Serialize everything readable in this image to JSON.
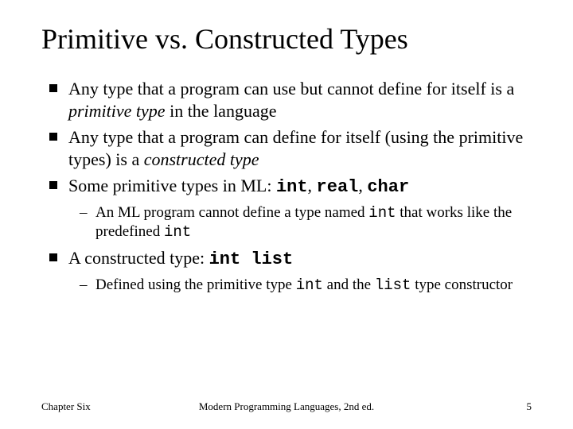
{
  "title": "Primitive vs. Constructed Types",
  "bullets": {
    "b1a": "Any type that a program can use but cannot define for itself is a ",
    "b1b": "primitive type",
    "b1c": " in the language",
    "b2a": "Any type that a program can define for itself (using the primitive types) is a ",
    "b2b": "constructed type",
    "b3a": "Some primitive types in ML: ",
    "b3_int": "int",
    "b3_c1": ", ",
    "b3_real": "real",
    "b3_c2": ", ",
    "b3_char": "char",
    "s3a": "An ML program cannot define a type named ",
    "s3b": "int",
    "s3c": " that works like the predefined ",
    "s3d": "int",
    "b4a": "A constructed type: ",
    "b4b": "int list",
    "s4a": "Defined using the primitive type ",
    "s4b": "int",
    "s4c": " and the ",
    "s4d": "list",
    "s4e": " type constructor"
  },
  "footer": {
    "left": "Chapter Six",
    "center": "Modern Programming Languages, 2nd ed.",
    "right": "5"
  }
}
